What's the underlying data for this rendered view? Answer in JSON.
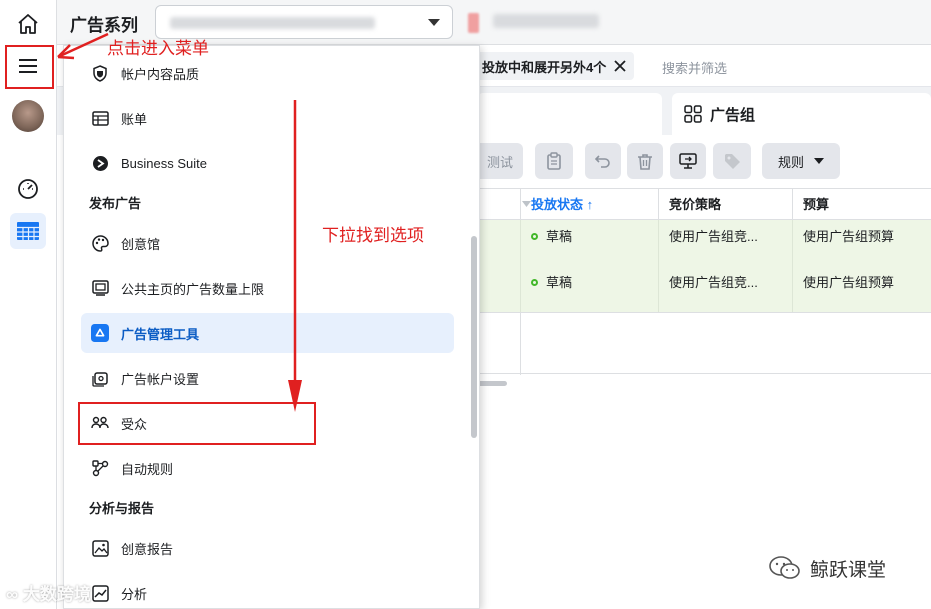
{
  "header": {
    "title": "广告系列"
  },
  "filter": {
    "chip_label": "投放中和展开另外4个",
    "search_placeholder": "搜索并筛选"
  },
  "tabs": {
    "adset_label": "广告组"
  },
  "toolbar": {
    "test_label": "测试",
    "rules_label": "规则"
  },
  "table": {
    "headers": [
      "投放状态 ↑",
      "竞价策略",
      "预算"
    ],
    "rows": [
      {
        "status": "草稿",
        "bid": "使用广告组竞...",
        "budget": "使用广告组预算"
      },
      {
        "status": "草稿",
        "bid": "使用广告组竞...",
        "budget": "使用广告组预算"
      }
    ]
  },
  "menu": {
    "item_quality": "帐户内容品质",
    "item_billing": "账单",
    "item_business_suite": "Business Suite",
    "section_publish": "发布广告",
    "item_creative_hub": "创意馆",
    "item_page_limit": "公共主页的广告数量上限",
    "item_ads_manager": "广告管理工具",
    "item_account_settings": "广告帐户设置",
    "item_audiences": "受众",
    "item_auto_rules": "自动规则",
    "section_analyze": "分析与报告",
    "item_creative_reports": "创意报告",
    "item_analytics": "分析"
  },
  "annotations": {
    "click_menu": "点击进入菜单",
    "scroll_find": "下拉找到选项",
    "color": "#e02020"
  },
  "watermarks": {
    "left": "大数跨境",
    "right": "鲸跃课堂"
  },
  "colors": {
    "accent": "#1877f2",
    "draft_row": "#eef6e6",
    "status_dot": "#42b72a"
  }
}
